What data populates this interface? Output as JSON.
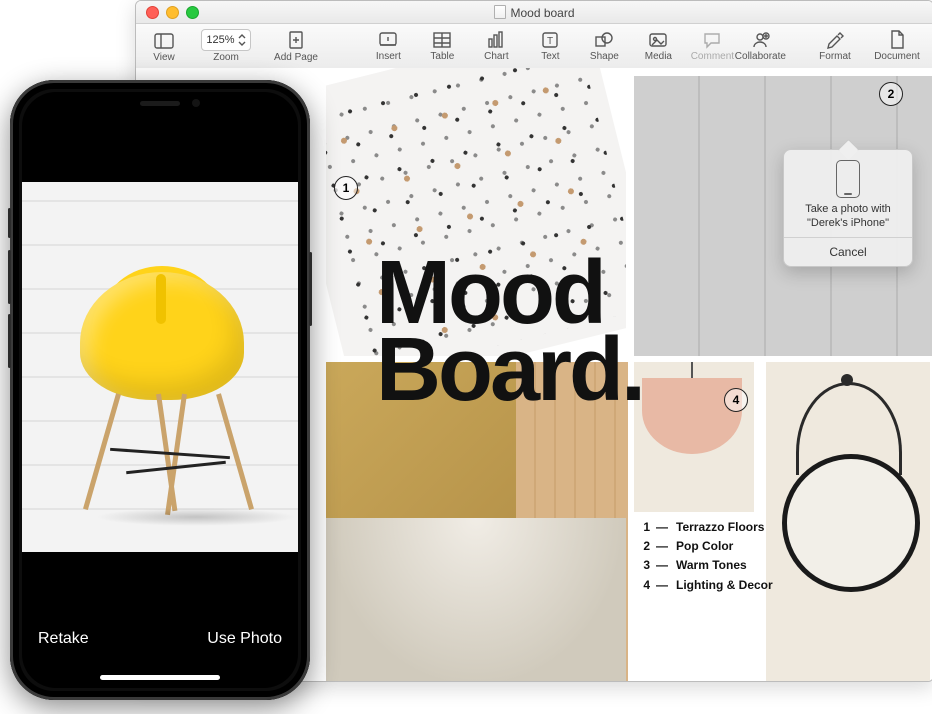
{
  "window": {
    "title": "Mood board",
    "zoom": "125%",
    "toolbar": {
      "view": "View",
      "zoom_label": "Zoom",
      "add_page": "Add Page",
      "insert": "Insert",
      "table": "Table",
      "chart": "Chart",
      "text": "Text",
      "shape": "Shape",
      "media": "Media",
      "comment": "Comment",
      "collaborate": "Collaborate",
      "format": "Format",
      "document": "Document"
    }
  },
  "document": {
    "title_line1": "Mood",
    "title_line2": "Board.",
    "callouts": {
      "c1": "1",
      "c2": "2",
      "c4": "4"
    },
    "legend": [
      {
        "num": "1",
        "label": "Terrazzo Floors"
      },
      {
        "num": "2",
        "label": "Pop Color"
      },
      {
        "num": "3",
        "label": "Warm Tones"
      },
      {
        "num": "4",
        "label": "Lighting & Decor"
      }
    ]
  },
  "popover": {
    "message": "Take a photo with \"Derek's iPhone\"",
    "cancel": "Cancel"
  },
  "iphone": {
    "retake": "Retake",
    "use_photo": "Use Photo"
  }
}
